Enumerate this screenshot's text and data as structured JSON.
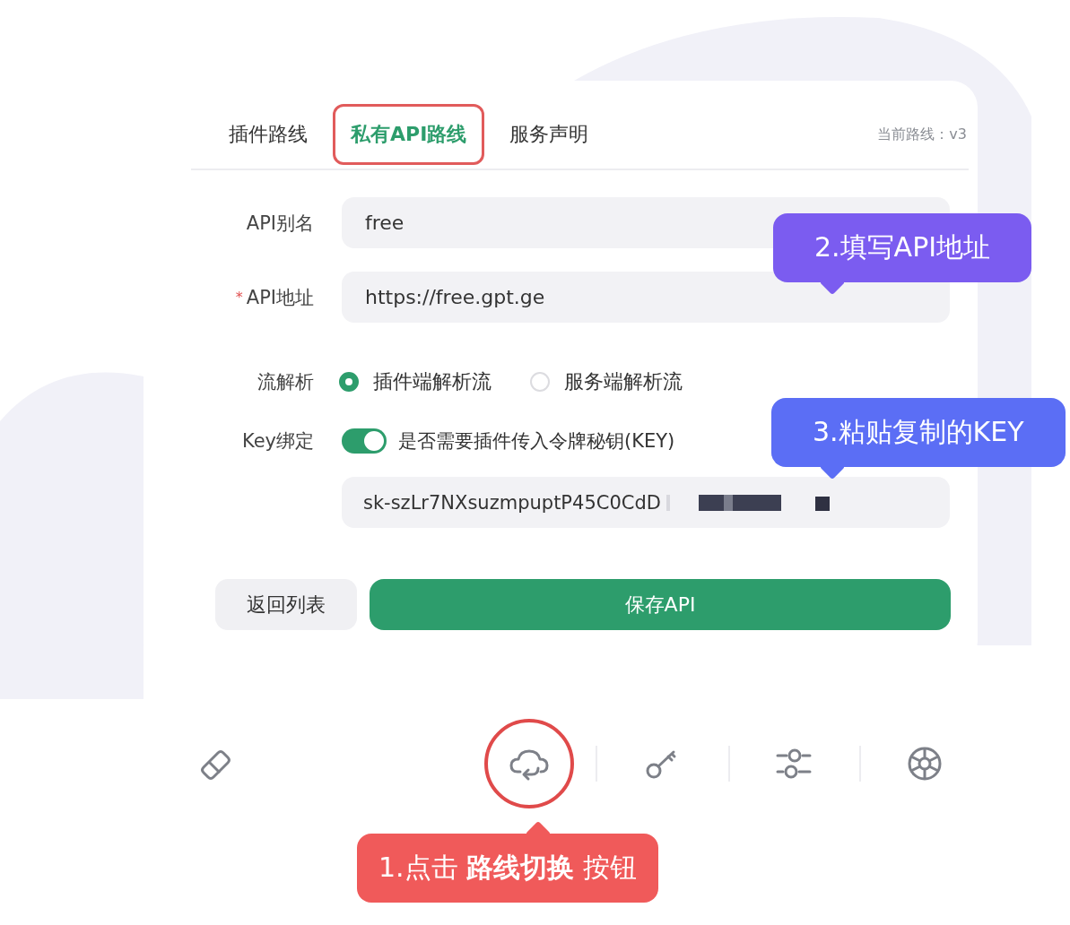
{
  "tabs": [
    {
      "label": "插件路线",
      "selected": false,
      "highlighted": false
    },
    {
      "label": "私有API路线",
      "selected": true,
      "highlighted": true
    },
    {
      "label": "服务声明",
      "selected": false,
      "highlighted": false
    }
  ],
  "current_route": "当前路线：v3",
  "form": {
    "alias": {
      "label": "API别名",
      "value": "free"
    },
    "api_url": {
      "label": "API地址",
      "required_mark": "*",
      "value": "https://free.gpt.ge"
    },
    "stream": {
      "label": "流解析",
      "options": [
        {
          "label": "插件端解析流",
          "selected": true
        },
        {
          "label": "服务端解析流",
          "selected": false
        }
      ]
    },
    "key_binding": {
      "label": "Key绑定",
      "on": true,
      "description": "是否需要插件传入令牌秘钥(KEY)"
    },
    "key": {
      "value": "sk-szLr7NXsuzmpuptP45C0CdD"
    }
  },
  "buttons": {
    "back": "返回列表",
    "save": "保存API"
  },
  "toolbar": [
    {
      "kind": "eraser",
      "highlighted": false
    },
    {
      "kind": "cloud",
      "highlighted": true
    },
    {
      "kind": "key",
      "highlighted": false
    },
    {
      "kind": "sliders",
      "highlighted": false
    },
    {
      "kind": "aperture",
      "highlighted": false
    }
  ],
  "callouts": [
    {
      "text": "2.填写API地址",
      "color": "#7b5cf0"
    },
    {
      "text": "3.粘贴复制的KEY",
      "color": "#5b6ef5"
    },
    {
      "text": "1.点击 **路线切换** 按钮",
      "color": "#f05a5a"
    }
  ]
}
